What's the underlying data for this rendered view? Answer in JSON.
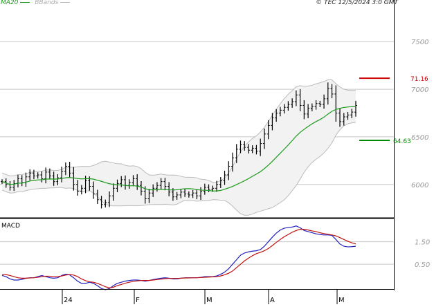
{
  "legend": {
    "ma20_label": "MA20",
    "bbands_label": "BBands"
  },
  "copyright": "© TEC 12/5/2024 3:0 GMT",
  "macd_title": "MACD",
  "colors": {
    "price_bar": "#000000",
    "ma20": "#1a9a1a",
    "bbands": "#bbbbbb",
    "bbands_fill": "#f2f2f2",
    "resistance": "#cc0000",
    "support": "#008800",
    "macd_line": "#2020c0",
    "signal_line": "#c01010",
    "grid": "#c8c8c8"
  },
  "chart_data": [
    {
      "type": "ohlc",
      "panel": "price",
      "y_ticks": [
        {
          "value": 75.0,
          "label": "7500"
        },
        {
          "value": 70.0,
          "label": "7000"
        },
        {
          "value": 65.0,
          "label": "6500"
        },
        {
          "value": 60.0,
          "label": "6000"
        }
      ],
      "x_ticks": [
        "24",
        "F",
        "M",
        "A",
        "M"
      ],
      "ylim": [
        56.5,
        78.5
      ],
      "levels": [
        {
          "name": "resistance",
          "value": 71.16,
          "label": "71.16"
        },
        {
          "name": "support",
          "value": 64.63,
          "label": "64.63"
        }
      ],
      "close": [
        60.3,
        60.0,
        59.7,
        60.1,
        60.6,
        60.2,
        60.8,
        61.2,
        60.9,
        61.0,
        60.6,
        61.3,
        60.9,
        60.3,
        60.7,
        61.4,
        61.9,
        61.2,
        60.0,
        59.3,
        59.6,
        60.4,
        59.8,
        59.0,
        58.4,
        57.9,
        58.1,
        58.8,
        59.6,
        60.1,
        60.5,
        59.9,
        60.2,
        60.6,
        59.9,
        59.3,
        58.5,
        59.1,
        59.6,
        59.9,
        60.3,
        59.8,
        59.2,
        58.7,
        58.9,
        59.2,
        59.0,
        58.9,
        59.1,
        58.8,
        59.3,
        59.7,
        59.5,
        59.6,
        60.0,
        60.4,
        61.0,
        61.9,
        62.8,
        63.7,
        64.2,
        63.9,
        63.6,
        63.8,
        63.5,
        64.3,
        65.3,
        66.2,
        67.0,
        67.5,
        67.8,
        68.1,
        68.4,
        68.7,
        69.4,
        68.3,
        67.4,
        68.0,
        68.2,
        68.5,
        68.4,
        69.0,
        70.1,
        69.5,
        67.5,
        66.6,
        67.1,
        67.3,
        67.6,
        68.3
      ]
    },
    {
      "type": "line",
      "panel": "macd",
      "y_ticks": [
        {
          "value": 1.5,
          "label": "1.50"
        },
        {
          "value": 0.5,
          "label": "0.50"
        }
      ],
      "ylim": [
        -0.6,
        2.5
      ],
      "series": [
        {
          "name": "MACD",
          "values": [
            0.0,
            -0.05,
            -0.15,
            -0.2,
            -0.2,
            -0.17,
            -0.12,
            -0.1,
            -0.1,
            -0.05,
            0.0,
            -0.05,
            -0.1,
            -0.12,
            -0.1,
            0.0,
            0.06,
            0.03,
            -0.1,
            -0.25,
            -0.35,
            -0.35,
            -0.3,
            -0.35,
            -0.45,
            -0.58,
            -0.63,
            -0.58,
            -0.45,
            -0.35,
            -0.3,
            -0.25,
            -0.22,
            -0.2,
            -0.2,
            -0.22,
            -0.25,
            -0.22,
            -0.18,
            -0.15,
            -0.12,
            -0.1,
            -0.12,
            -0.15,
            -0.15,
            -0.12,
            -0.1,
            -0.1,
            -0.1,
            -0.1,
            -0.08,
            -0.05,
            -0.05,
            -0.05,
            -0.02,
            0.05,
            0.15,
            0.3,
            0.5,
            0.7,
            0.9,
            1.0,
            1.05,
            1.08,
            1.1,
            1.15,
            1.3,
            1.5,
            1.7,
            1.88,
            2.02,
            2.1,
            2.13,
            2.15,
            2.2,
            2.12,
            2.0,
            1.95,
            1.9,
            1.85,
            1.82,
            1.8,
            1.8,
            1.78,
            1.6,
            1.4,
            1.3,
            1.27,
            1.28,
            1.3
          ]
        },
        {
          "name": "Signal",
          "values": [
            0.05,
            0.04,
            0.0,
            -0.05,
            -0.1,
            -0.12,
            -0.12,
            -0.11,
            -0.1,
            -0.08,
            -0.05,
            -0.03,
            -0.03,
            -0.05,
            -0.05,
            -0.02,
            0.02,
            0.04,
            0.02,
            -0.05,
            -0.15,
            -0.23,
            -0.28,
            -0.3,
            -0.35,
            -0.42,
            -0.5,
            -0.55,
            -0.52,
            -0.45,
            -0.4,
            -0.34,
            -0.3,
            -0.26,
            -0.24,
            -0.22,
            -0.22,
            -0.22,
            -0.2,
            -0.18,
            -0.16,
            -0.14,
            -0.13,
            -0.13,
            -0.13,
            -0.12,
            -0.11,
            -0.11,
            -0.1,
            -0.1,
            -0.09,
            -0.08,
            -0.07,
            -0.06,
            -0.05,
            -0.02,
            0.03,
            0.1,
            0.2,
            0.35,
            0.5,
            0.65,
            0.77,
            0.88,
            0.97,
            1.03,
            1.1,
            1.2,
            1.33,
            1.47,
            1.6,
            1.72,
            1.82,
            1.92,
            2.0,
            2.05,
            2.05,
            2.02,
            1.98,
            1.95,
            1.9,
            1.86,
            1.83,
            1.8,
            1.76,
            1.68,
            1.6,
            1.52,
            1.45,
            1.4
          ]
        }
      ]
    }
  ]
}
